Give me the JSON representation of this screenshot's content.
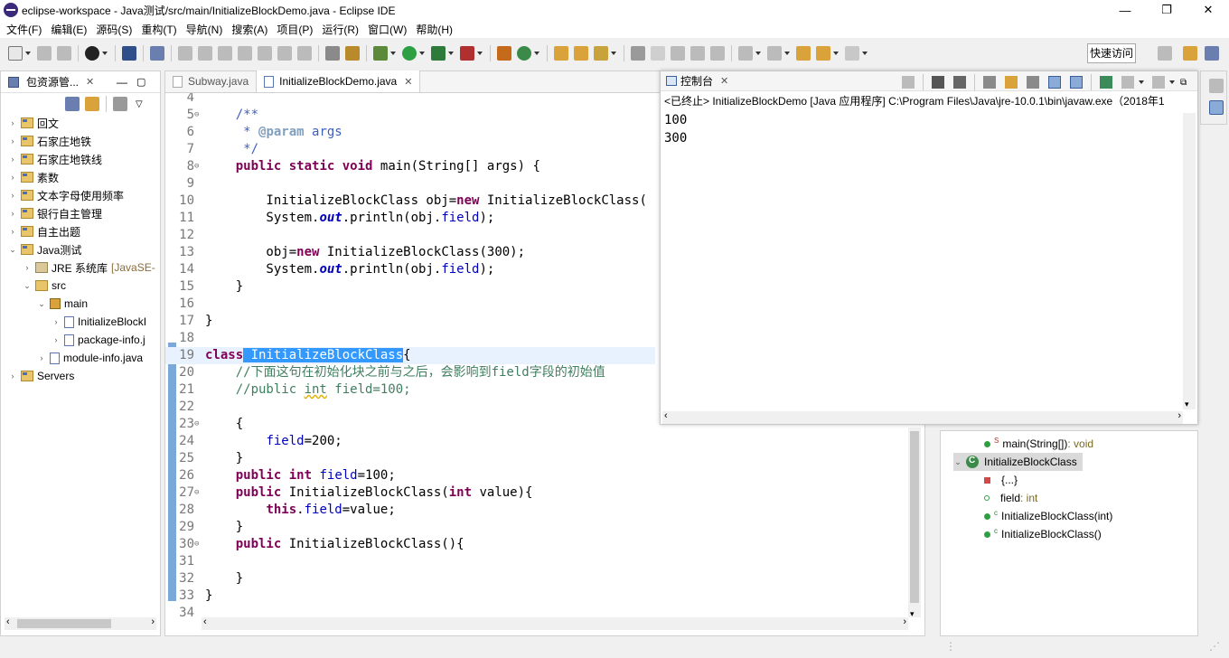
{
  "window": {
    "title": "eclipse-workspace - Java测试/src/main/InitializeBlockDemo.java - Eclipse IDE",
    "minimize": "—",
    "maximize": "❐",
    "close": "✕"
  },
  "menu": [
    "文件(F)",
    "编辑(E)",
    "源码(S)",
    "重构(T)",
    "导航(N)",
    "搜索(A)",
    "项目(P)",
    "运行(R)",
    "窗口(W)",
    "帮助(H)"
  ],
  "toolbar": {
    "quick_access": "快速访问"
  },
  "package_explorer": {
    "title": "包资源管...",
    "items": [
      {
        "label": "回文",
        "type": "project"
      },
      {
        "label": "石家庄地铁",
        "type": "project"
      },
      {
        "label": "石家庄地铁线",
        "type": "project"
      },
      {
        "label": "素数",
        "type": "project"
      },
      {
        "label": "文本字母使用频率",
        "type": "project"
      },
      {
        "label": "银行自主管理",
        "type": "project"
      },
      {
        "label": "自主出题",
        "type": "project"
      },
      {
        "label": "Java测试",
        "type": "project"
      },
      {
        "label": "JRE 系统库",
        "suffix": "[JavaSE-",
        "type": "library"
      },
      {
        "label": "src",
        "type": "source"
      },
      {
        "label": "main",
        "type": "package"
      },
      {
        "label": "InitializeBlockI",
        "type": "java"
      },
      {
        "label": "package-info.j",
        "type": "java"
      },
      {
        "label": "module-info.java",
        "type": "java"
      },
      {
        "label": "Servers",
        "type": "project"
      }
    ]
  },
  "editor": {
    "tabs": [
      {
        "label": "Subway.java",
        "active": false
      },
      {
        "label": "InitializeBlockDemo.java",
        "active": true
      }
    ],
    "line_numbers": [
      "4",
      "5",
      "6",
      "7",
      "8",
      "9",
      "10",
      "11",
      "12",
      "13",
      "14",
      "15",
      "16",
      "17",
      "18",
      "19",
      "20",
      "21",
      "22",
      "23",
      "24",
      "25",
      "26",
      "27",
      "28",
      "29",
      "30",
      "31",
      "32",
      "33",
      "34"
    ]
  },
  "console": {
    "title": "控制台",
    "status": "<已终止> InitializeBlockDemo [Java 应用程序] C:\\Program Files\\Java\\jre-10.0.1\\bin\\javaw.exe（2018年1",
    "output": [
      "100",
      "300"
    ]
  },
  "outline": {
    "items": [
      {
        "label": "main(String[])",
        "suffix": " : void"
      },
      {
        "label": "InitializeBlockClass"
      },
      {
        "label": "{...}"
      },
      {
        "label": "field",
        "suffix": " : int"
      },
      {
        "label": "InitializeBlockClass(int)"
      },
      {
        "label": "InitializeBlockClass()"
      }
    ],
    "method_marker": "S",
    "ctor_marker": "c"
  },
  "colors": {
    "keyword": "#7f0055",
    "comment": "#3f7f5f",
    "field": "#0000c0",
    "selection": "#3399ff"
  }
}
